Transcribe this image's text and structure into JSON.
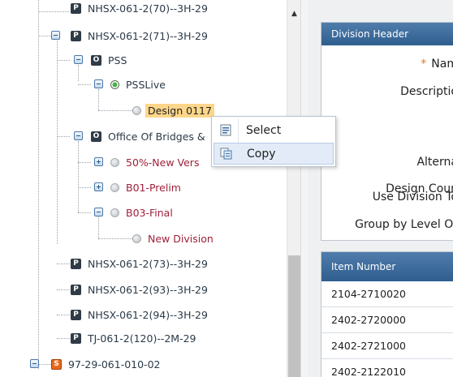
{
  "tree": {
    "nodes": [
      {
        "badge": "P",
        "label": "NHSX-061-2(70)--3H-29"
      },
      {
        "badge": "P",
        "label": "NHSX-061-2(71)--3H-29"
      },
      {
        "badge": "O",
        "label": "PSS"
      },
      {
        "label": "PSSLive"
      },
      {
        "label": "Design 0117"
      },
      {
        "badge": "O",
        "label": "Office Of Bridges &"
      },
      {
        "label": "50%-New Vers"
      },
      {
        "label": "B01-Prelim"
      },
      {
        "label": "B03-Final"
      },
      {
        "label": "New Division"
      },
      {
        "badge": "P",
        "label": "NHSX-061-2(73)--3H-29"
      },
      {
        "badge": "P",
        "label": "NHSX-061-2(93)--3H-29"
      },
      {
        "badge": "P",
        "label": "NHSX-061-2(94)--3H-29"
      },
      {
        "badge": "P",
        "label": "TJ-061-2(120)--2M-29"
      },
      {
        "badge": "S",
        "label": "97-29-061-010-02"
      }
    ],
    "selected_index": 4
  },
  "context_menu": {
    "items": [
      {
        "label": "Select",
        "icon": "select-icon"
      },
      {
        "label": "Copy",
        "icon": "copy-icon"
      }
    ],
    "hovered_index": 1
  },
  "division_panel": {
    "header": "Division Header",
    "required_mark": "*",
    "fields": [
      "Nam",
      "Descriptio",
      "Alterna",
      "Design Coun",
      "Use Division To",
      "Group by Level Or"
    ]
  },
  "item_panel": {
    "header": "Item Number",
    "rows": [
      "2104-2710020",
      "2402-2720000",
      "2402-2721000",
      "2402-2122010"
    ]
  },
  "colors": {
    "header_blue": "#3a6a9c",
    "selected_highlight": "#fdd68a",
    "division_red": "#a0203a",
    "live_green": "#47b348",
    "badge_orange": "#e8681c"
  }
}
